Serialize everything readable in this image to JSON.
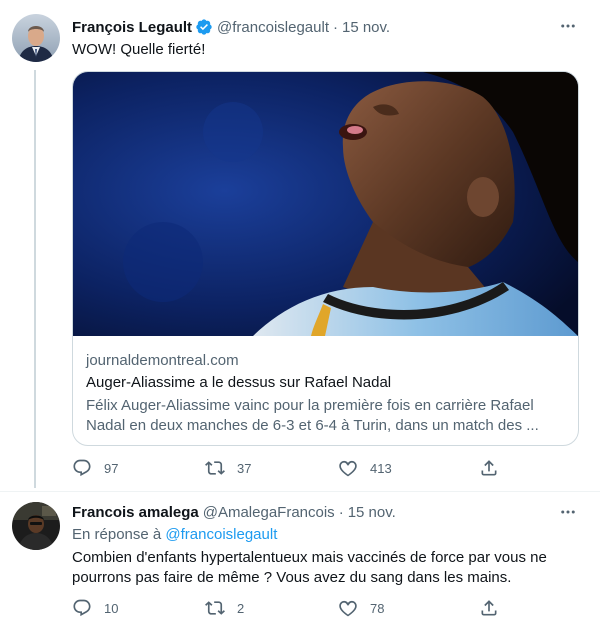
{
  "tweet1": {
    "name": "François Legault",
    "handle": "@francoislegault",
    "separator": "·",
    "time": "15 nov.",
    "text": "WOW! Quelle fierté!",
    "card": {
      "domain": "journaldemontreal.com",
      "title": "Auger-Aliassime a le dessus sur Rafael Nadal",
      "description": "Félix Auger-Aliassime vainc pour la première fois en carrière Rafael Nadal en deux manches de 6-3 et 6-4 à Turin, dans un match des ..."
    },
    "actions": {
      "replies": "97",
      "retweets": "37",
      "likes": "413"
    }
  },
  "tweet2": {
    "name": "Francois amalega",
    "handle": "@AmalegaFrancois",
    "separator": "·",
    "time": "15 nov.",
    "reply_prefix": "En réponse à",
    "reply_to": "@francoislegault",
    "text_line1": "Combien d'enfants hypertalentueux mais vaccinés de force par vous ne",
    "text_line2": "pourrons pas faire de même ? Vous avez du sang dans les mains.",
    "actions": {
      "replies": "10",
      "retweets": "2",
      "likes": "78"
    }
  },
  "colors": {
    "accent": "#1d9bf0",
    "secondary_text": "#536471",
    "border": "#cfd9de"
  },
  "icons": [
    "more-icon",
    "verified-icon",
    "reply-icon",
    "retweet-icon",
    "like-icon",
    "share-icon"
  ]
}
